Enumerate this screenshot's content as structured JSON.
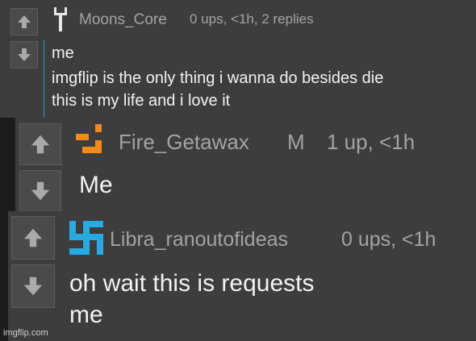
{
  "comments": [
    {
      "username": "Moons_Core",
      "meta": "0 ups, <1h, 2 replies",
      "lines": [
        "me",
        "imgflip is the only thing i wanna do besides die",
        "this is my life and i love it"
      ],
      "avatar_icon": "tuning-fork-icon"
    },
    {
      "username": "Fire_Getawax",
      "badge": "M",
      "meta": "1 up, <1h",
      "lines": [
        "Me"
      ],
      "avatar_icon": "orange-glyph-icon"
    },
    {
      "username": "Libra_ranoutofideas",
      "meta": "0 ups, <1h",
      "lines": [
        "oh wait this is requests",
        "me"
      ],
      "avatar_icon": "blue-swastika-icon"
    }
  ],
  "watermark": "imgflip.com",
  "colors": {
    "background": "#1c1c1c",
    "panel": "#3d3d3d",
    "username": "#a3a3a3",
    "text": "#f2f2f2",
    "accent_line": "#1fa5c2",
    "orange": "#f28a1e",
    "blue": "#27a9e1"
  }
}
